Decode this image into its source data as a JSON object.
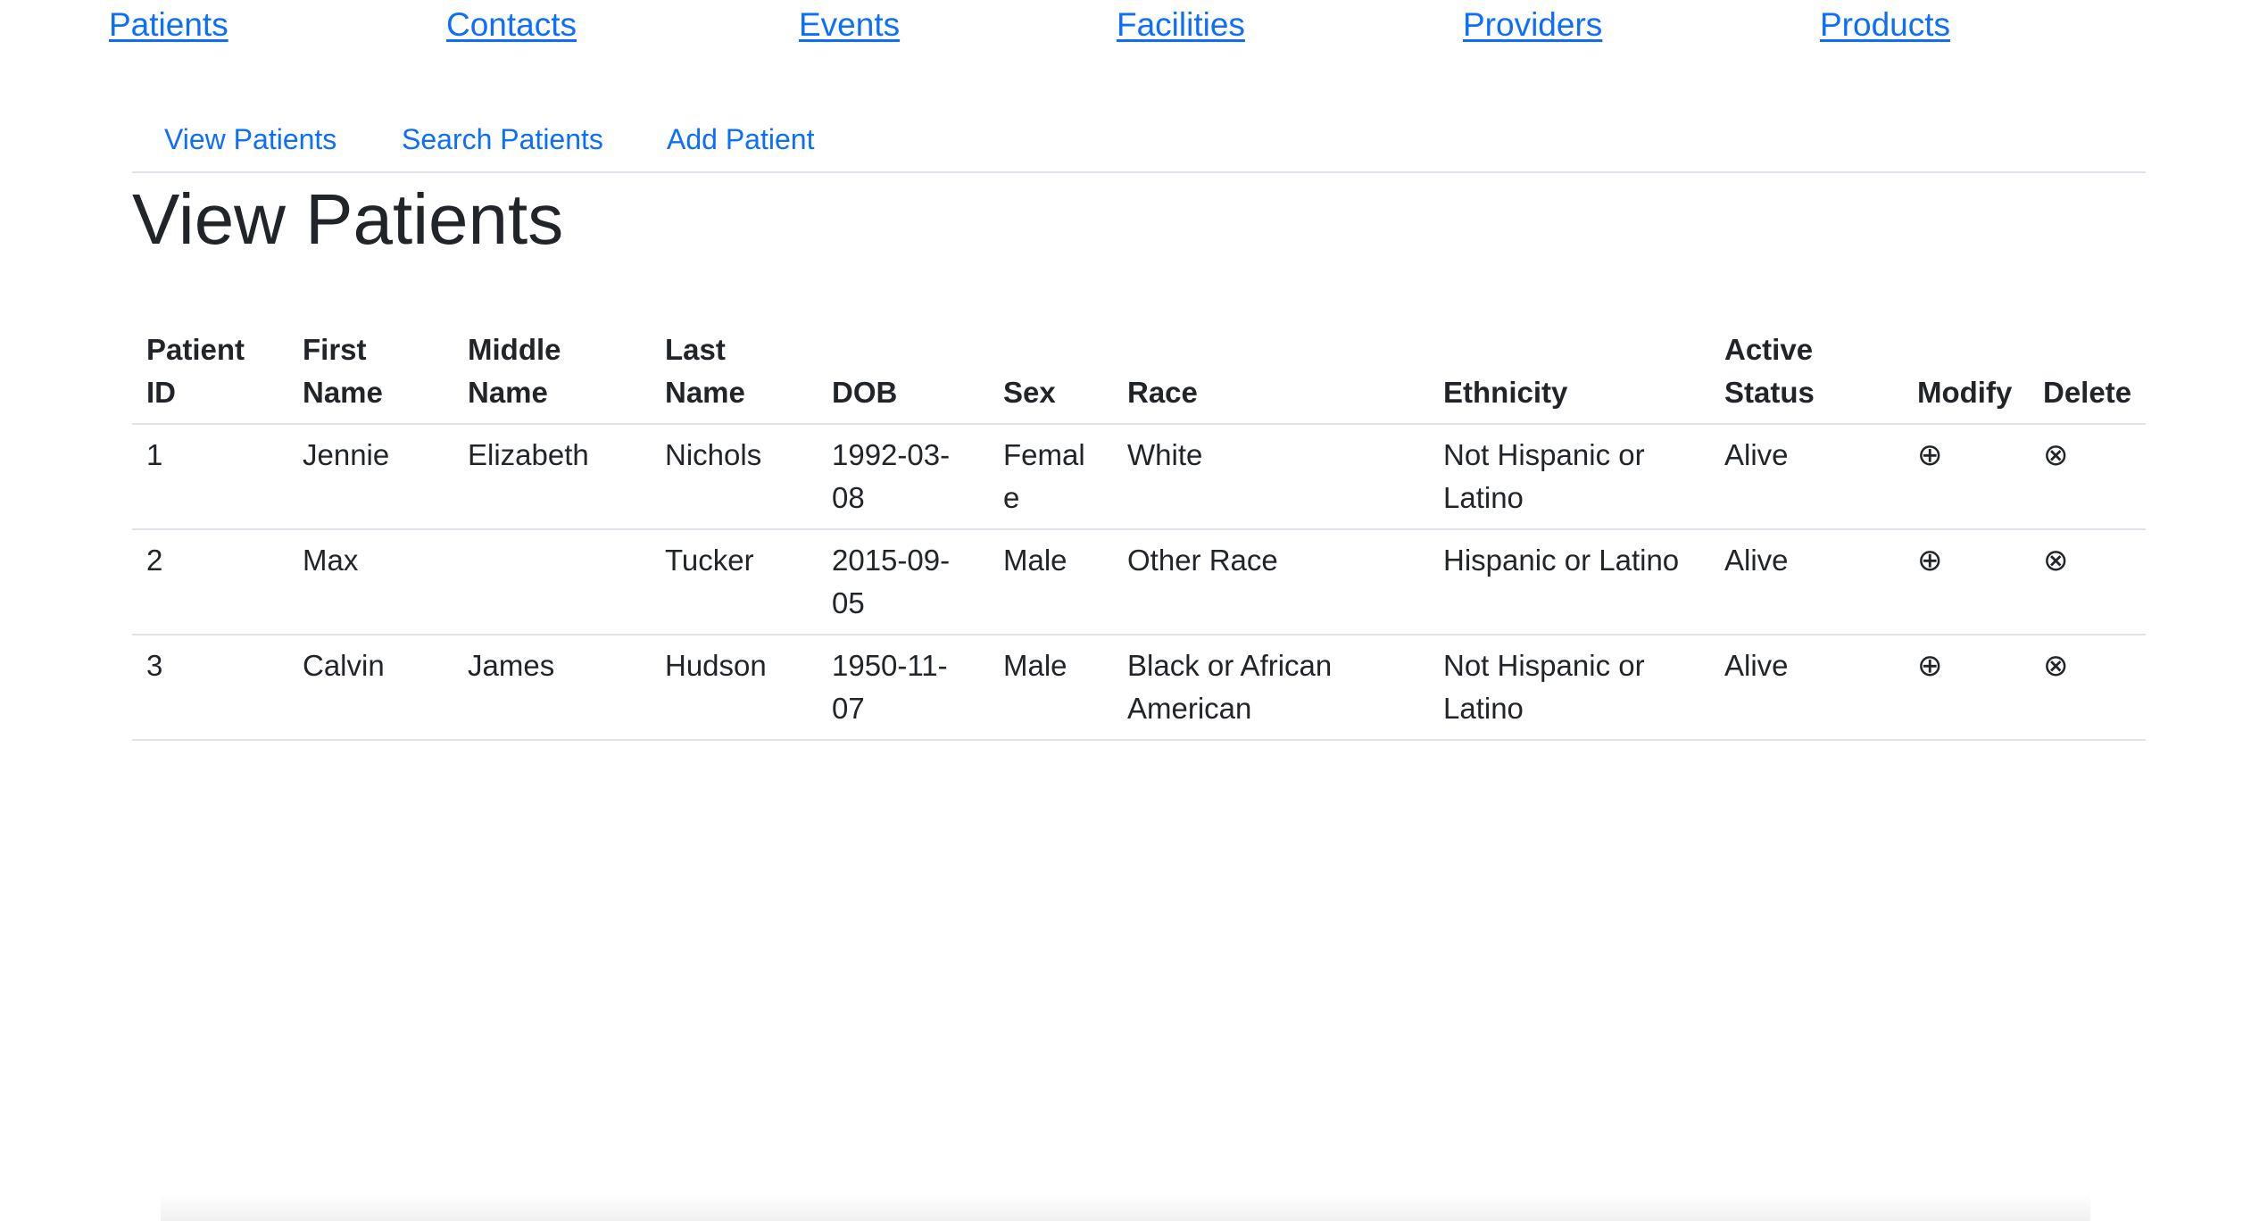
{
  "top_nav": {
    "patients": "Patients",
    "contacts": "Contacts",
    "events": "Events",
    "facilities": "Facilities",
    "providers": "Providers",
    "products": "Products"
  },
  "sub_nav": {
    "view_patients": "View Patients",
    "search_patients": "Search Patients",
    "add_patient": "Add Patient"
  },
  "page_title": "View Patients",
  "table": {
    "headers": {
      "patient_id": "Patient ID",
      "first_name": "First Name",
      "middle_name": "Middle Name",
      "last_name": "Last Name",
      "dob": "DOB",
      "sex": "Sex",
      "race": "Race",
      "ethnicity": "Ethnicity",
      "active_status": "Active Status",
      "modify": "Modify",
      "delete": "Delete"
    },
    "rows": [
      {
        "patient_id": "1",
        "first_name": "Jennie",
        "middle_name": "Elizabeth",
        "last_name": "Nichols",
        "dob": "1992-03-08",
        "sex": "Female",
        "race": "White",
        "ethnicity": "Not Hispanic or Latino",
        "active_status": "Alive"
      },
      {
        "patient_id": "2",
        "first_name": "Max",
        "middle_name": "",
        "last_name": "Tucker",
        "dob": "2015-09-05",
        "sex": "Male",
        "race": "Other Race",
        "ethnicity": "Hispanic or Latino",
        "active_status": "Alive"
      },
      {
        "patient_id": "3",
        "first_name": "Calvin",
        "middle_name": "James",
        "last_name": "Hudson",
        "dob": "1950-11-07",
        "sex": "Male",
        "race": "Black or African American",
        "ethnicity": "Not Hispanic or Latino",
        "active_status": "Alive"
      }
    ],
    "modify_icon": "⊕",
    "delete_icon": "⊗"
  },
  "icons": {
    "modify": "circled-plus-icon",
    "delete": "circled-times-icon"
  },
  "colors": {
    "link": "#0d6efd",
    "text": "#212529",
    "border": "#dee2e6"
  }
}
